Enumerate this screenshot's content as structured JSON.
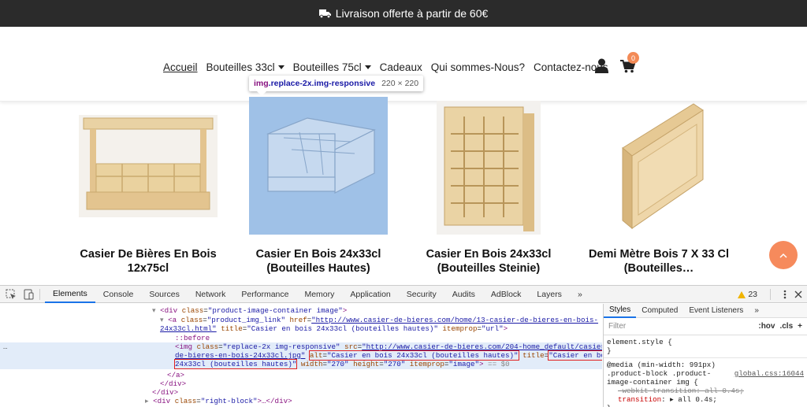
{
  "banner": {
    "text": "Livraison offerte à partir de 60€"
  },
  "nav": {
    "items": [
      {
        "label": "Accueil"
      },
      {
        "label": "Bouteilles 33cl"
      },
      {
        "label": "Bouteilles 75cl"
      },
      {
        "label": "Cadeaux"
      },
      {
        "label": "Qui sommes-Nous?"
      },
      {
        "label": "Contactez-nous"
      }
    ],
    "cart_count": "0"
  },
  "tooltip": {
    "tag": "img",
    "class": ".replace-2x.img-responsive",
    "dims": "220 × 220"
  },
  "products": [
    {
      "title_line1": "Casier De Bières En Bois",
      "title_line2": "12x75cl"
    },
    {
      "title_line1": "Casier En Bois 24x33cl",
      "title_line2": "(Bouteilles Hautes)"
    },
    {
      "title_line1": "Casier En Bois 24x33cl",
      "title_line2": "(Bouteilles Steinie)"
    },
    {
      "title_line1": "Demi Mètre Bois 7 X 33 Cl",
      "title_line2": "(Bouteilles…"
    }
  ],
  "devtools": {
    "tabs": [
      "Elements",
      "Console",
      "Sources",
      "Network",
      "Performance",
      "Memory",
      "Application",
      "Security",
      "Audits",
      "AdBlock",
      "Layers"
    ],
    "more": "»",
    "warnings": "23",
    "code": {
      "l1_tag_open": "<div ",
      "l1_attr": "class",
      "l1_val": "\"product-image-container image\"",
      "l1_close": ">",
      "l2_tag": "<a ",
      "l2_attr1": "class",
      "l2_val1": "\"product_img_link\"",
      "l2_attr2": " href",
      "l2_link1": "\"http://www.casier-de-bieres.com/home/13-casier-de-bieres-en-bois-",
      "l3_link2": "24x33cl.html\"",
      "l3_attr3": " title",
      "l3_val3": "\"Casier en bois 24x33cl (bouteilles hautes)\"",
      "l3_attr4": " itemprop",
      "l3_val4": "\"url\"",
      "l3_close": ">",
      "l4": "::before",
      "l5_tag": "<img ",
      "l5_attr1": "class",
      "l5_val1": "\"replace-2x img-responsive\"",
      "l5_attr2": " src",
      "l5_link": "\"http://www.casier-de-bieres.com/204-home_default/casier-",
      "l6_link": "de-bieres-en-bois-24x33cl.jpg\"",
      "l6_alt_attr": "alt",
      "l6_alt_val": "\"Casier en bois 24x33cl (bouteilles hautes)\"",
      "l6_title_attr": " title",
      "l6_title_val": "\"Casier en bois",
      "l7_title_val": "24x33cl (bouteilles hautes)\"",
      "l7_attr_w": " width",
      "l7_val_w": "\"270\"",
      "l7_attr_h": " height",
      "l7_val_h": "\"270\"",
      "l7_attr_i": " itemprop",
      "l7_val_i": "\"image\"",
      "l7_close": ">",
      "l7_eq": " == $0",
      "l8": "</a>",
      "l9": "</div>",
      "l10": "</div>",
      "l11_tag": "<div ",
      "l11_attr": "class",
      "l11_val": "\"right-block\"",
      "l11_rest": ">…</div>"
    },
    "styles": {
      "tabs": [
        "Styles",
        "Computed",
        "Event Listeners",
        "»"
      ],
      "filter_placeholder": "Filter",
      "hov": ":hov",
      "cls": ".cls",
      "plus": "+",
      "element_style": "element.style {",
      "element_close": "}",
      "media": "@media (min-width: 991px)",
      "selector1": ".product-block .product-",
      "selector2": "image-container img {",
      "source": "global.css:16044",
      "prop1": "-webkit-transition: all 0.4s;",
      "prop2_name": "transition",
      "prop2_val": ": ▸ all 0.4s;",
      "close": "}"
    }
  }
}
